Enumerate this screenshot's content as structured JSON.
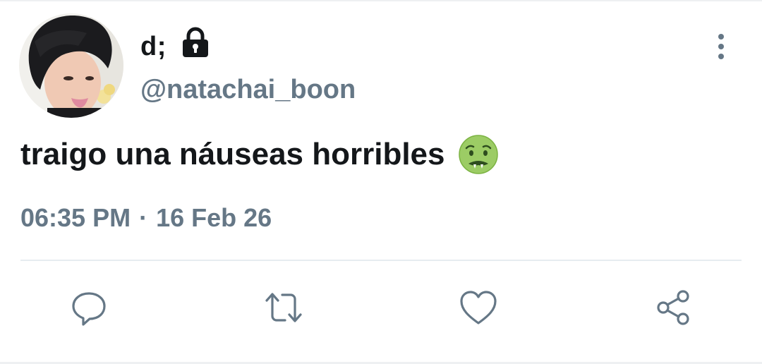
{
  "tweet": {
    "author": {
      "display_name": "d;",
      "handle": "@natachai_boon",
      "protected": true,
      "avatar_alt": "avatar"
    },
    "text": "traigo una náuseas horribles",
    "emoji": "nauseated-face",
    "time": "06:35 PM",
    "separator": "·",
    "date": "16 Feb 26"
  },
  "actions": [
    {
      "name": "reply",
      "icon": "comment-icon"
    },
    {
      "name": "retweet",
      "icon": "retweet-icon"
    },
    {
      "name": "like",
      "icon": "heart-icon"
    },
    {
      "name": "share",
      "icon": "share-icon"
    }
  ],
  "colors": {
    "text_primary": "#14171a",
    "text_secondary": "#657786",
    "icon": "#657786",
    "divider": "#e6ecf0"
  }
}
